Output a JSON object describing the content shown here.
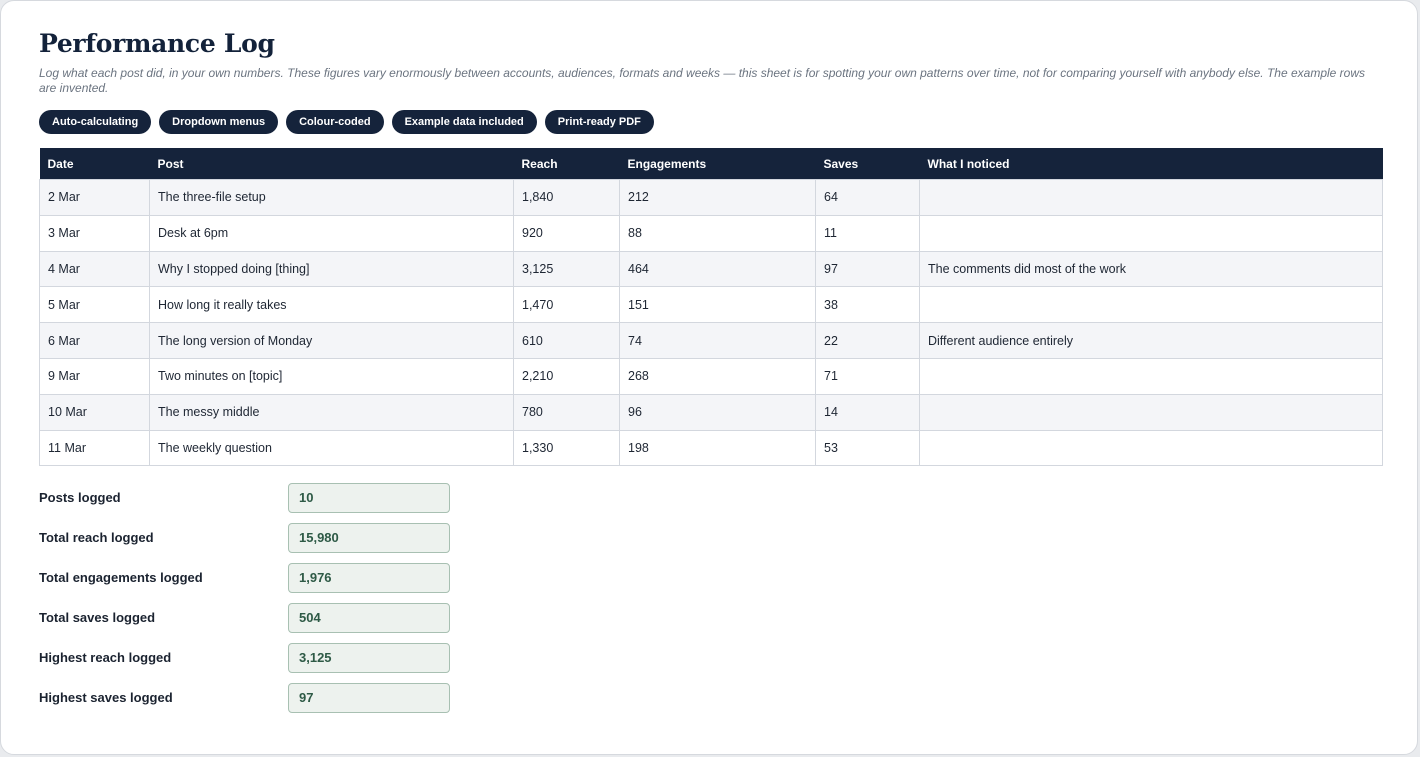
{
  "header": {
    "title": "Performance Log",
    "subtitle": "Log what each post did, in your own numbers. These figures vary enormously between accounts, audiences, formats and weeks — this sheet is for spotting your own patterns over time, not for comparing yourself with anybody else. The example rows are invented."
  },
  "pills": [
    "Auto-calculating",
    "Dropdown menus",
    "Colour-coded",
    "Example data included",
    "Print-ready PDF"
  ],
  "table": {
    "columns": [
      "Date",
      "Post",
      "Reach",
      "Engagements",
      "Saves",
      "What I noticed"
    ],
    "rows": [
      [
        "2 Mar",
        "The three-file setup",
        "1,840",
        "212",
        "64",
        ""
      ],
      [
        "3 Mar",
        "Desk at 6pm",
        "920",
        "88",
        "11",
        ""
      ],
      [
        "4 Mar",
        "Why I stopped doing [thing]",
        "3,125",
        "464",
        "97",
        "The comments did most of the work"
      ],
      [
        "5 Mar",
        "How long it really takes",
        "1,470",
        "151",
        "38",
        ""
      ],
      [
        "6 Mar",
        "The long version of Monday",
        "610",
        "74",
        "22",
        "Different audience entirely"
      ],
      [
        "9 Mar",
        "Two minutes on [topic]",
        "2,210",
        "268",
        "71",
        ""
      ],
      [
        "10 Mar",
        "The messy middle",
        "780",
        "96",
        "14",
        ""
      ],
      [
        "11 Mar",
        "The weekly question",
        "1,330",
        "198",
        "53",
        ""
      ]
    ]
  },
  "summary": [
    {
      "label": "Posts logged",
      "value": "10"
    },
    {
      "label": "Total reach logged",
      "value": "15,980"
    },
    {
      "label": "Total engagements logged",
      "value": "1,976"
    },
    {
      "label": "Total saves logged",
      "value": "504"
    },
    {
      "label": "Highest reach logged",
      "value": "3,125"
    },
    {
      "label": "Highest saves logged",
      "value": "97"
    }
  ],
  "colors": {
    "navy": "#15233b",
    "summary_fill": "#edf2ee",
    "summary_text": "#2e5a46"
  }
}
